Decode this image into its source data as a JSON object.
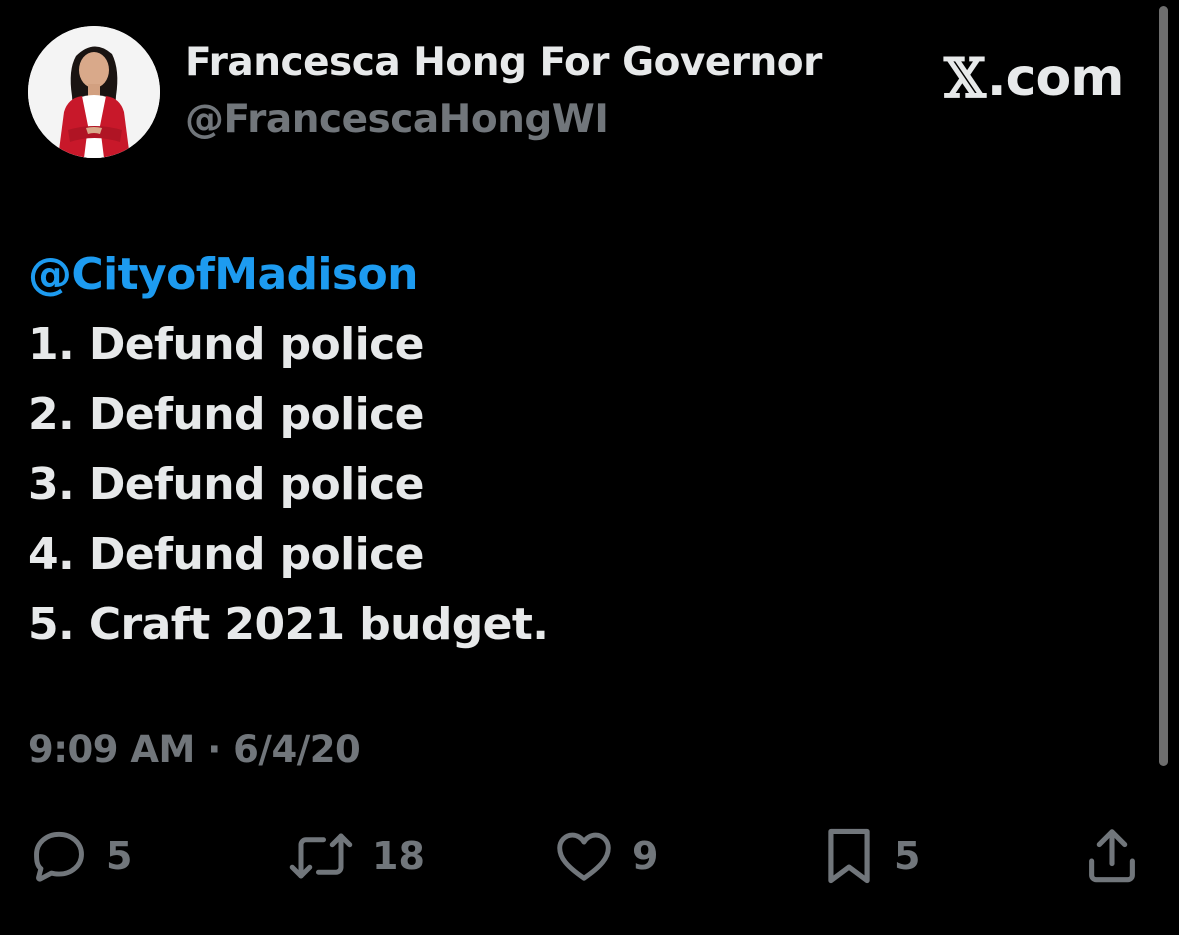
{
  "author": {
    "display_name": "Francesca Hong For Governor",
    "handle": "@FrancescaHongWI",
    "avatar_icon": "profile-photo"
  },
  "brand": {
    "mark": "𝕏",
    "suffix": ".com"
  },
  "tweet": {
    "mention": "@CityofMadison",
    "lines": [
      "1. Defund police",
      "2. Defund police",
      "3. Defund police",
      "4. Defund police",
      "5. Craft 2021 budget."
    ],
    "timestamp": "9:09 AM · 6/4/20"
  },
  "actions": {
    "reply": {
      "icon": "reply-icon",
      "count": "5"
    },
    "retweet": {
      "icon": "retweet-icon",
      "count": "18"
    },
    "like": {
      "icon": "heart-icon",
      "count": "9"
    },
    "bookmark": {
      "icon": "bookmark-icon",
      "count": "5"
    },
    "share": {
      "icon": "share-icon"
    }
  },
  "colors": {
    "background": "#000000",
    "text_primary": "#e7e9ea",
    "text_secondary": "#71767b",
    "mention": "#1d9bf0"
  }
}
